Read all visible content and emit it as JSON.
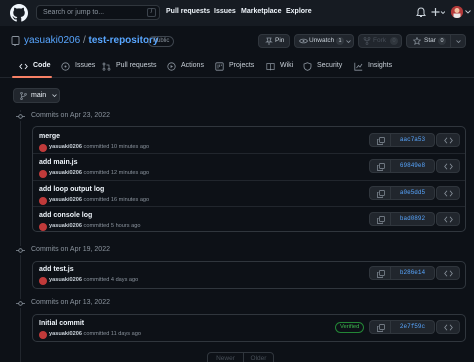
{
  "header": {
    "search_placeholder": "Search or jump to...",
    "search_shortcut": "/",
    "nav": [
      "Pull requests",
      "Issues",
      "Marketplace",
      "Explore"
    ]
  },
  "repo": {
    "owner": "yasuaki0206",
    "separator": "/",
    "name": "test-repository",
    "visibility": "Public",
    "pin_label": "Pin",
    "watch_label": "Unwatch",
    "watch_count": "1",
    "fork_label": "Fork",
    "fork_count": "0",
    "star_label": "Star",
    "star_count": "0"
  },
  "tabs": [
    "Code",
    "Issues",
    "Pull requests",
    "Actions",
    "Projects",
    "Wiki",
    "Security",
    "Insights"
  ],
  "branch": {
    "name": "main"
  },
  "groups": [
    {
      "date": "Commits on Apr 23, 2022",
      "commits": [
        {
          "message": "merge",
          "author": "yasuaki0206",
          "when": "committed 10 minutes ago",
          "sha": "aac7a53",
          "verified": ""
        },
        {
          "message": "add main.js",
          "author": "yasuaki0206",
          "when": "committed 12 minutes ago",
          "sha": "69849e8",
          "verified": ""
        },
        {
          "message": "add loop output log",
          "author": "yasuaki0206",
          "when": "committed 16 minutes ago",
          "sha": "a0e5dd5",
          "verified": ""
        },
        {
          "message": "add console log",
          "author": "yasuaki0206",
          "when": "committed 5 hours ago",
          "sha": "bad0892",
          "verified": ""
        }
      ]
    },
    {
      "date": "Commits on Apr 19, 2022",
      "commits": [
        {
          "message": "add test.js",
          "author": "yasuaki0206",
          "when": "committed 4 days ago",
          "sha": "b286e14",
          "verified": ""
        }
      ]
    },
    {
      "date": "Commits on Apr 13, 2022",
      "commits": [
        {
          "message": "Initial commit",
          "author": "yasuaki0206",
          "when": "committed 11 days ago",
          "sha": "2e7f59c",
          "verified": "Verified"
        }
      ]
    }
  ],
  "pagination": {
    "newer": "Newer",
    "older": "Older"
  },
  "colors": {
    "accent": "#58a6ff",
    "tab_underline": "#f78166",
    "verified": "#3fb950"
  }
}
